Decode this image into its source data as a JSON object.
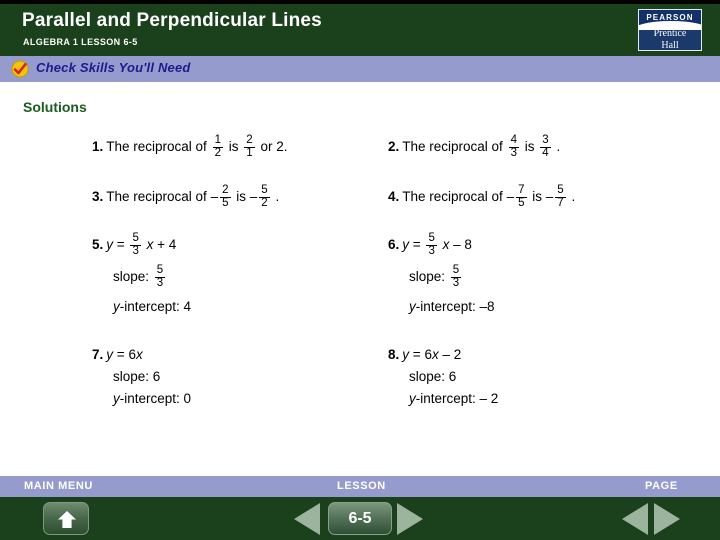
{
  "header": {
    "title": "Parallel and Perpendicular Lines",
    "subtitle": "ALGEBRA 1 LESSON 6-5",
    "logo_top": "PEARSON",
    "logo_bottom_line1": "Prentice",
    "logo_bottom_line2": "Hall",
    "bg_color": "#1a401c"
  },
  "banner": {
    "text": "Check Skills You'll Need",
    "icon": "check-circle-icon",
    "bg_color": "#959ccd",
    "text_color": "#1e1a8c"
  },
  "body": {
    "section_label": "Solutions",
    "section_label_color": "#1c5c1c"
  },
  "problems": [
    {
      "number": "1.",
      "prefix": "The reciprocal of",
      "frac1_num": "1",
      "frac1_den": "2",
      "mid": "is",
      "frac2_num": "2",
      "frac2_den": "1",
      "suffix": "or 2."
    },
    {
      "number": "2.",
      "prefix": "The reciprocal of",
      "frac1_num": "4",
      "frac1_den": "3",
      "mid": "is",
      "frac2_num": "3",
      "frac2_den": "4",
      "suffix": "."
    },
    {
      "number": "3.",
      "prefix": "The reciprocal of",
      "sign1": "–",
      "frac1_num": "2",
      "frac1_den": "5",
      "mid": "is",
      "sign2": "–",
      "frac2_num": "5",
      "frac2_den": "2",
      "suffix": "."
    },
    {
      "number": "4.",
      "prefix": "The reciprocal of",
      "sign1": "–",
      "frac1_num": "7",
      "frac1_den": "5",
      "mid": "is",
      "sign2": "–",
      "frac2_num": "5",
      "frac2_den": "7",
      "suffix": "."
    },
    {
      "number": "5.",
      "eq_lhs": "y",
      "eq_mid": "=",
      "frac1_num": "5",
      "frac1_den": "3",
      "eq_var": "x",
      "eq_rhs": "+ 4",
      "slope_label": "slope:",
      "slope_num": "5",
      "slope_den": "3",
      "intercept_var": "y",
      "intercept_label": "-intercept: 4"
    },
    {
      "number": "6.",
      "eq_lhs": "y",
      "eq_mid": "=",
      "frac1_num": "5",
      "frac1_den": "3",
      "eq_var": "x",
      "eq_rhs": "– 8",
      "slope_label": "slope:",
      "slope_num": "5",
      "slope_den": "3",
      "intercept_var": "y",
      "intercept_label": "-intercept: –8"
    },
    {
      "number": "7.",
      "eq_lhs": "y",
      "eq_mid": "=",
      "eq_plain": "6",
      "eq_var": "x",
      "eq_rhs": "",
      "slope_label": "slope: 6",
      "intercept_var": "y",
      "intercept_label": "-intercept: 0"
    },
    {
      "number": "8.",
      "eq_lhs": "y",
      "eq_mid": "=",
      "eq_plain": "6",
      "eq_var": "x",
      "eq_rhs": "– 2",
      "slope_label": "slope: 6",
      "intercept_var": "y",
      "intercept_label": "-intercept: – 2"
    }
  ],
  "footer": {
    "main_menu_label": "MAIN MENU",
    "lesson_label": "LESSON",
    "page_label": "PAGE",
    "lesson_number": "6-5",
    "band_color": "#959ccd",
    "bg_color": "#1a401c"
  }
}
